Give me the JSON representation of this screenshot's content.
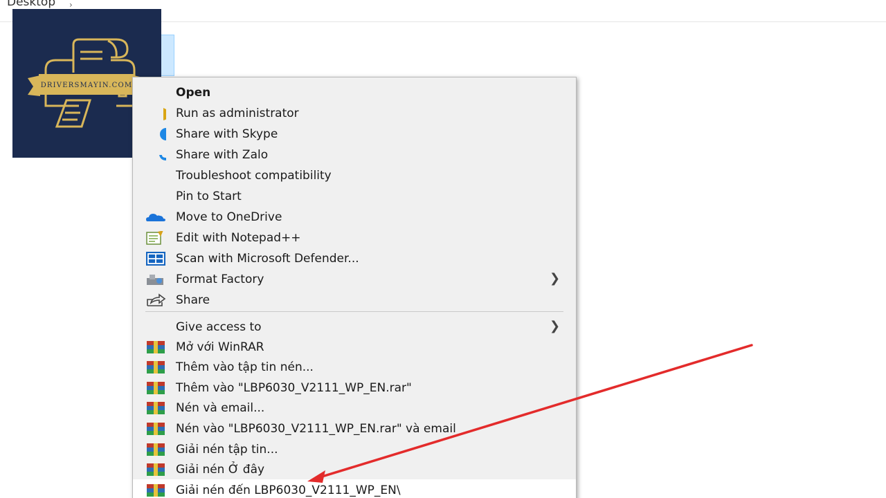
{
  "breadcrumb": {
    "label": "Desktop"
  },
  "logo": {
    "text": "DRIVERSMAYIN.COM"
  },
  "menu": {
    "items": [
      {
        "label": "Open",
        "icon": "none",
        "bold": true
      },
      {
        "label": "Run as administrator",
        "icon": "shield-icon"
      },
      {
        "label": "Share with Skype",
        "icon": "skype-icon"
      },
      {
        "label": "Share with Zalo",
        "icon": "zalo-icon"
      },
      {
        "label": "Troubleshoot compatibility",
        "icon": "none"
      },
      {
        "label": "Pin to Start",
        "icon": "none"
      },
      {
        "label": "Move to OneDrive",
        "icon": "onedrive-icon"
      },
      {
        "label": "Edit with Notepad++",
        "icon": "notepad-icon"
      },
      {
        "label": "Scan with Microsoft Defender...",
        "icon": "defender-icon"
      },
      {
        "label": "Format Factory",
        "icon": "formatfactory-icon",
        "submenu": true
      },
      {
        "label": "Share",
        "icon": "share-icon"
      },
      {
        "label": "Give access to",
        "icon": "none",
        "submenu": true
      },
      {
        "label": "Mở với WinRAR",
        "icon": "winrar-icon"
      },
      {
        "label": "Thêm vào tập tin nén...",
        "icon": "winrar-icon"
      },
      {
        "label": "Thêm vào \"LBP6030_V2111_WP_EN.rar\"",
        "icon": "winrar-icon"
      },
      {
        "label": "Nén và email...",
        "icon": "winrar-icon"
      },
      {
        "label": "Nén vào \"LBP6030_V2111_WP_EN.rar\" và email",
        "icon": "winrar-icon"
      },
      {
        "label": "Giải nén tập tin...",
        "icon": "winrar-icon"
      },
      {
        "label": "Giải nén Ở đây",
        "icon": "winrar-icon"
      },
      {
        "label": "Giải nén đến LBP6030_V2111_WP_EN\\",
        "icon": "winrar-icon",
        "highlighted": true
      }
    ]
  },
  "colors": {
    "arrow": "#e32b2b",
    "logo_bg": "#1b2b4f",
    "logo_gold": "#d8b65a"
  }
}
